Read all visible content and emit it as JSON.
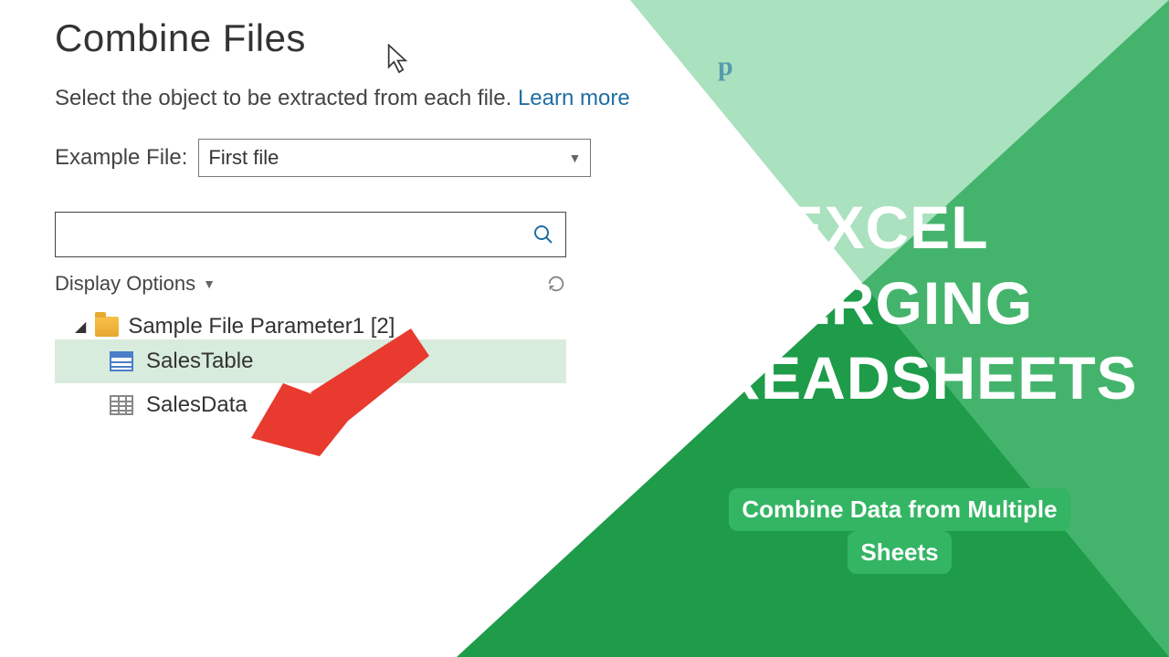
{
  "dialog": {
    "title": "Combine Files",
    "subtitle_prefix": "Select the object to be extracted from each file. ",
    "learn_more": "Learn more",
    "example_file_label": "Example File:",
    "example_file_value": "First file",
    "display_options": "Display Options",
    "tree": {
      "folder_name": "Sample File Parameter1 [2]",
      "items": [
        {
          "name": "SalesTable",
          "selected": true,
          "kind": "table"
        },
        {
          "name": "SalesData",
          "selected": false,
          "kind": "sheet"
        }
      ]
    }
  },
  "overlay": {
    "headline_line1": "EXCEL",
    "headline_line2": "MERGING",
    "headline_line3": "SPREADSHEETS",
    "pill_line1": "Combine Data from Multiple",
    "pill_line2": "Sheets"
  },
  "stray_char": "p"
}
